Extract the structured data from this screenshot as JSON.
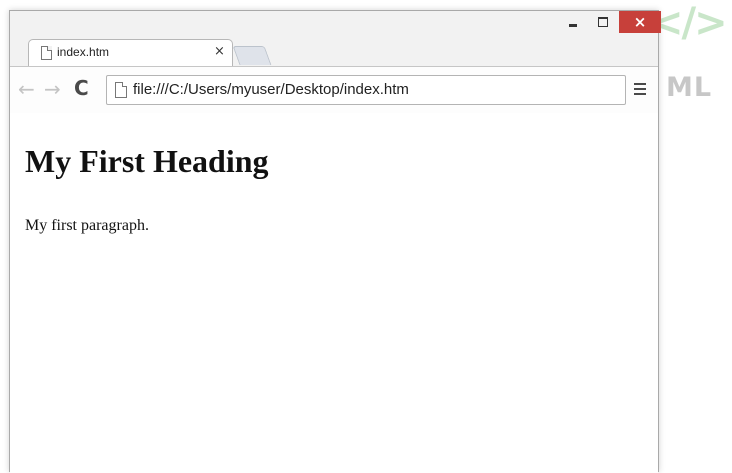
{
  "background": {
    "logo_code": "</>",
    "logo_text": "ML"
  },
  "window": {
    "controls": {
      "minimize_icon": "minimize-icon",
      "maximize_icon": "maximize-icon",
      "close_label": "×",
      "close_color": "#c7403a"
    }
  },
  "tabs": [
    {
      "title": "index.htm",
      "close_label": "×"
    }
  ],
  "toolbar": {
    "back_label": "←",
    "forward_label": "→",
    "reload_label": "C",
    "address": "file:///C:/Users/myuser/Desktop/index.htm"
  },
  "page": {
    "heading": "My First Heading",
    "paragraph": "My first paragraph."
  }
}
